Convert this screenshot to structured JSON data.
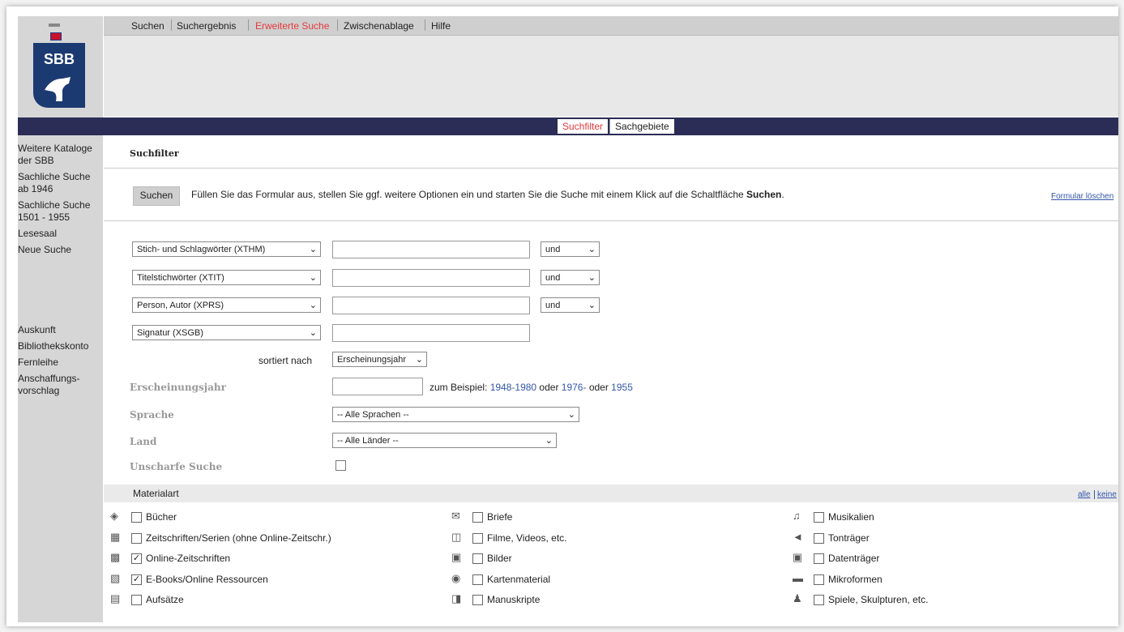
{
  "topnav": {
    "tabs": [
      "Suchen",
      "Suchergebnis",
      "Erweiterte Suche",
      "Zwischenablage",
      "Hilfe"
    ],
    "active_index": 2
  },
  "logo": {
    "text": "SBB"
  },
  "subtabs": {
    "filter": "Suchfilter",
    "subjects": "Sachgebiete"
  },
  "sidebar": {
    "items_top": [
      "Weitere Kataloge der SBB",
      "Sachliche Suche ab 1946",
      "Sachliche Suche 1501 - 1955",
      "Lesesaal",
      "Neue Suche"
    ],
    "items_bottom": [
      "Auskunft",
      "Bibliothekskonto",
      "Fernleihe",
      "Anschaffungs-vorschlag"
    ]
  },
  "form": {
    "heading": "Suchfilter",
    "search_button": "Suchen",
    "hint_prefix": "Füllen Sie das Formular aus, stellen Sie ggf. weitere Optionen ein und starten Sie die Suche mit einem Klick auf die Schaltfläche ",
    "hint_bold": "Suchen",
    "hint_suffix": ".",
    "clear_link": "Formular löschen",
    "rows": [
      {
        "field": "Stich- und Schlagwörter (XTHM)",
        "value": "",
        "operator": "und"
      },
      {
        "field": "Titelstichwörter (XTIT)",
        "value": "",
        "operator": "und"
      },
      {
        "field": "Person, Autor (XPRS)",
        "value": "",
        "operator": "und"
      },
      {
        "field": "Signatur (XSGB)",
        "value": ""
      }
    ],
    "sort_label": "sortiert nach",
    "sort_value": "Erscheinungsjahr",
    "year_label": "Erscheinungsjahr",
    "year_value": "",
    "example_prefix": "zum Beispiel: ",
    "example_1": "1948-1980",
    "example_or1": " oder ",
    "example_2": "1976-",
    "example_or2": " oder ",
    "example_3": "1955",
    "language_label": "Sprache",
    "language_value": "-- Alle Sprachen --",
    "country_label": "Land",
    "country_value": "-- Alle Länder --",
    "fuzzy_label": "Unscharfe Suche",
    "fuzzy_checked": false
  },
  "material": {
    "title": "Materialart",
    "all_link": "alle",
    "none_link": "keine",
    "col1": [
      {
        "label": "Bücher",
        "checked": false,
        "icon": "book-icon"
      },
      {
        "label": "Zeitschriften/Serien (ohne Online-Zeitschr.)",
        "checked": false,
        "icon": "journal-icon"
      },
      {
        "label": "Online-Zeitschriften",
        "checked": true,
        "icon": "online-journal-icon"
      },
      {
        "label": "E-Books/Online Ressourcen",
        "checked": true,
        "icon": "ebook-icon"
      },
      {
        "label": "Aufsätze",
        "checked": false,
        "icon": "article-icon"
      }
    ],
    "col2": [
      {
        "label": "Briefe",
        "checked": false,
        "icon": "letter-icon"
      },
      {
        "label": "Filme, Videos, etc.",
        "checked": false,
        "icon": "film-icon"
      },
      {
        "label": "Bilder",
        "checked": false,
        "icon": "camera-icon"
      },
      {
        "label": "Kartenmaterial",
        "checked": false,
        "icon": "globe-icon"
      },
      {
        "label": "Manuskripte",
        "checked": false,
        "icon": "manuscript-icon"
      }
    ],
    "col3": [
      {
        "label": "Musikalien",
        "checked": false,
        "icon": "music-icon"
      },
      {
        "label": "Tonträger",
        "checked": false,
        "icon": "speaker-icon"
      },
      {
        "label": "Datenträger",
        "checked": false,
        "icon": "disk-icon"
      },
      {
        "label": "Mikroformen",
        "checked": false,
        "icon": "microform-icon"
      },
      {
        "label": "Spiele, Skulpturen, etc.",
        "checked": false,
        "icon": "sculpture-icon"
      }
    ]
  }
}
